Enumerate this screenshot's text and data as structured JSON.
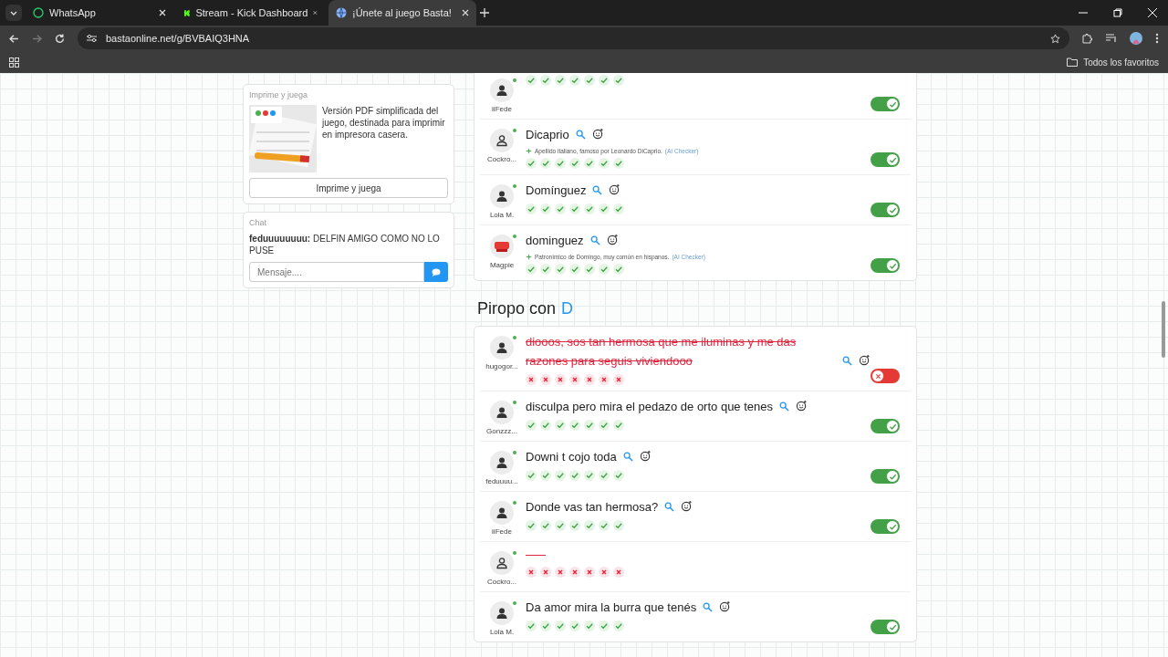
{
  "browser": {
    "tabs": [
      {
        "title": "WhatsApp",
        "selected": false,
        "kind": "whatsapp"
      },
      {
        "title": "Stream - Kick Dashboard",
        "selected": false,
        "kind": "kick"
      },
      {
        "title": "¡Únete al juego Basta!",
        "selected": true,
        "kind": "globe"
      }
    ],
    "url": "bastaonline.net/g/BVBAIQ3HNA",
    "bookmarks": "Todos los favoritos"
  },
  "print_card": {
    "title": "Imprime y juega",
    "description": "Versión PDF simplificada del juego, destinada para imprimir en impresora casera.",
    "button": "Imprime y juega"
  },
  "chat": {
    "title": "Chat",
    "messages": [
      {
        "user": "feduuuuuuuu:",
        "text": "DELFIN AMIGO COMO NO LO PUSE"
      }
    ],
    "placeholder": "Mensaje...."
  },
  "sections": [
    {
      "rows": [
        {
          "user": "iiFede",
          "kind": "person",
          "valid": true,
          "votes": [
            true,
            true,
            true,
            true,
            true,
            true,
            true
          ]
        },
        {
          "user": "Cockro...",
          "kind": "outline",
          "word": "Dicaprio",
          "description": "Apellido italiano, famoso por Leonardo DiCaprio.",
          "checker": "(AI Checker)",
          "valid": true,
          "votes": [
            true,
            true,
            true,
            true,
            true,
            true,
            true
          ]
        },
        {
          "user": "Lola M.",
          "kind": "person",
          "word": "Domínguez",
          "valid": true,
          "votes": [
            true,
            true,
            true,
            true,
            true,
            true,
            true
          ]
        },
        {
          "user": "Magpie",
          "kind": "stop",
          "word": "dominguez",
          "description": "Patronímico de Domingo, muy común en hispanos.",
          "checker": "(AI Checker)",
          "valid": true,
          "votes": [
            true,
            true,
            true,
            true,
            true,
            true,
            true
          ]
        }
      ]
    },
    {
      "title": "Piropo con",
      "letter": "D",
      "rows": [
        {
          "user": "hugogor...",
          "kind": "person",
          "word": "diooos, sos tan hermosa que me iluminas y me das razones para seguis viviendooo",
          "valid": false,
          "votes": [
            false,
            false,
            false,
            false,
            false,
            false,
            false
          ]
        },
        {
          "user": "Gonzzz...",
          "kind": "person",
          "word": "disculpa pero mira el pedazo de orto que tenes",
          "valid": true,
          "votes": [
            true,
            true,
            true,
            true,
            true,
            true,
            true
          ]
        },
        {
          "user": "feduuuu...",
          "kind": "person",
          "word": "Downi t cojo toda",
          "valid": true,
          "votes": [
            true,
            true,
            true,
            true,
            true,
            true,
            true
          ]
        },
        {
          "user": "iiFede",
          "kind": "person",
          "word": "Donde vas tan hermosa?",
          "valid": true,
          "votes": [
            true,
            true,
            true,
            true,
            true,
            true,
            true
          ]
        },
        {
          "user": "Cockro...",
          "kind": "outline",
          "blank": true,
          "votes": [
            false,
            false,
            false,
            false,
            false,
            false,
            false
          ]
        },
        {
          "user": "Lola M.",
          "kind": "person",
          "word": "Da amor mira la burra que tenés",
          "valid": true,
          "votes": [
            true,
            true,
            true,
            true,
            true,
            true,
            true
          ]
        }
      ]
    }
  ]
}
